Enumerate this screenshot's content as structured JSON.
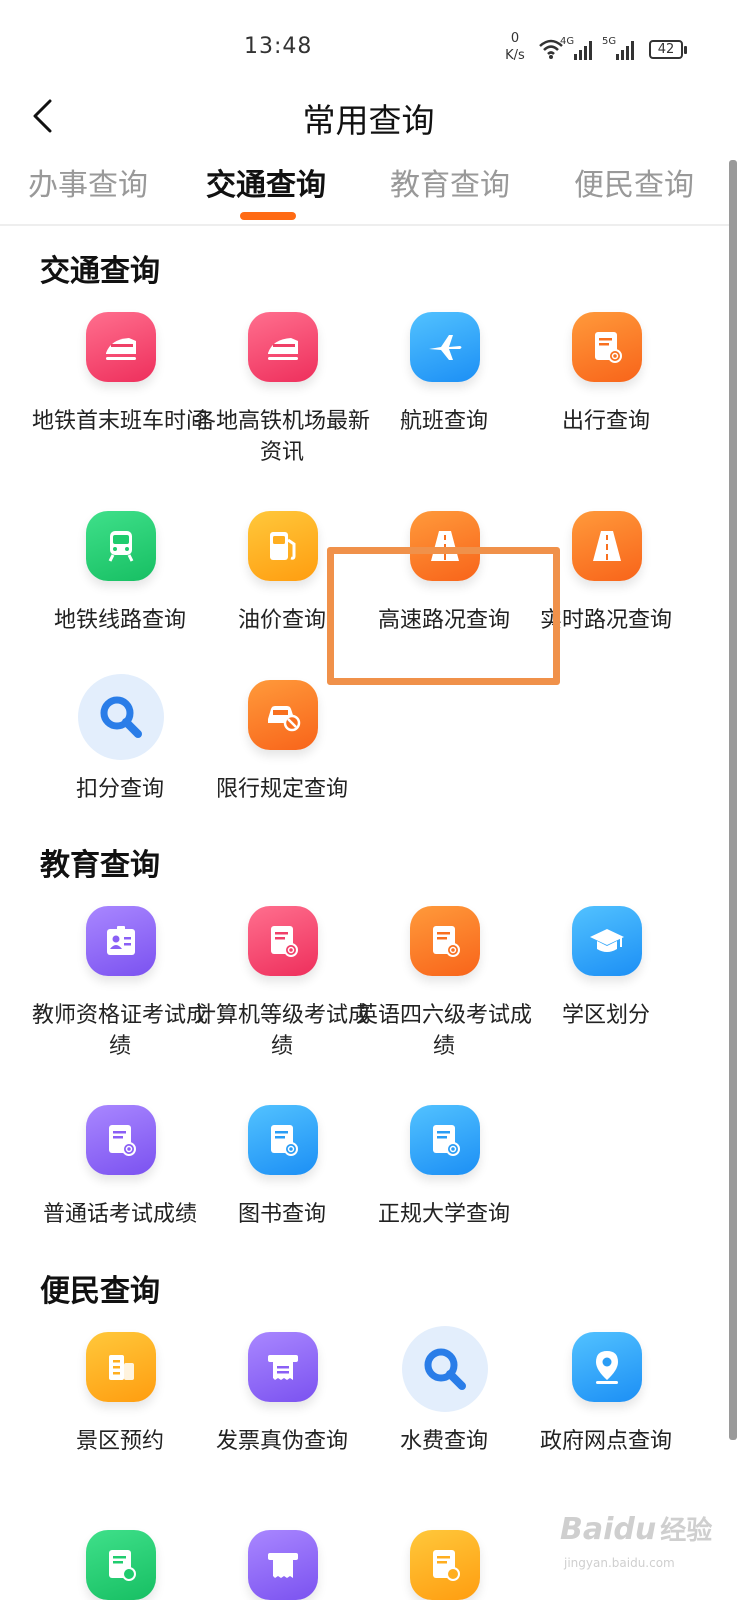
{
  "status_bar": {
    "time": "13:48",
    "net_speed_value": "0",
    "net_speed_unit": "K/s",
    "signal_1_label": "4G",
    "signal_2_label": "5G",
    "battery": "42"
  },
  "header": {
    "title": "常用查询"
  },
  "tabs": [
    {
      "label": "办事查询",
      "active": false
    },
    {
      "label": "交通查询",
      "active": true
    },
    {
      "label": "教育查询",
      "active": false
    },
    {
      "label": "便民查询",
      "active": false
    }
  ],
  "sections": [
    {
      "title": "交通查询",
      "items": [
        {
          "label": "地铁首末班车时间",
          "icon": "train-icon",
          "color": "#f03f69"
        },
        {
          "label": "各地高铁机场最新资讯",
          "icon": "train-icon",
          "color": "#f03f69"
        },
        {
          "label": "航班查询",
          "icon": "airplane-icon",
          "color": "#2a9df5"
        },
        {
          "label": "出行查询",
          "icon": "document-search-icon",
          "color": "#f8701f"
        },
        {
          "label": "地铁线路查询",
          "icon": "subway-icon",
          "color": "#1fcc6e"
        },
        {
          "label": "油价查询",
          "icon": "fuel-pump-icon",
          "color": "#ffae1f"
        },
        {
          "label": "高速路况查询",
          "icon": "highway-icon",
          "color": "#f8701f"
        },
        {
          "label": "实时路况查询",
          "icon": "road-icon",
          "color": "#f8701f"
        },
        {
          "label": "扣分查询",
          "icon": "magnifier-icon",
          "color": "#2a7de8"
        },
        {
          "label": "限行规定查询",
          "icon": "car-restricted-icon",
          "color": "#f8701f"
        }
      ]
    },
    {
      "title": "教育查询",
      "items": [
        {
          "label": "教师资格证考试成绩",
          "icon": "id-card-icon",
          "color": "#8a5ff5"
        },
        {
          "label": "计算机等级考试成绩",
          "icon": "document-search-icon",
          "color": "#f03f69"
        },
        {
          "label": "英语四六级考试成绩",
          "icon": "document-search-icon",
          "color": "#f8701f"
        },
        {
          "label": "学区划分",
          "icon": "graduation-cap-icon",
          "color": "#2a9df5"
        },
        {
          "label": "普通话考试成绩",
          "icon": "document-search-icon",
          "color": "#8a5ff5"
        },
        {
          "label": "图书查询",
          "icon": "document-search-icon",
          "color": "#2a9df5"
        },
        {
          "label": "正规大学查询",
          "icon": "document-search-icon",
          "color": "#2a9df5"
        }
      ]
    },
    {
      "title": "便民查询",
      "items": [
        {
          "label": "景区预约",
          "icon": "building-icon",
          "color": "#ffae1f"
        },
        {
          "label": "发票真伪查询",
          "icon": "receipt-icon",
          "color": "#8a5ff5"
        },
        {
          "label": "水费查询",
          "icon": "magnifier-icon",
          "color": "#2a7de8"
        },
        {
          "label": "政府网点查询",
          "icon": "location-pin-icon",
          "color": "#2a9df5"
        }
      ]
    }
  ],
  "watermark": {
    "brand": "Baidu",
    "suffix": "经验",
    "url": "jingyan.baidu.com"
  }
}
